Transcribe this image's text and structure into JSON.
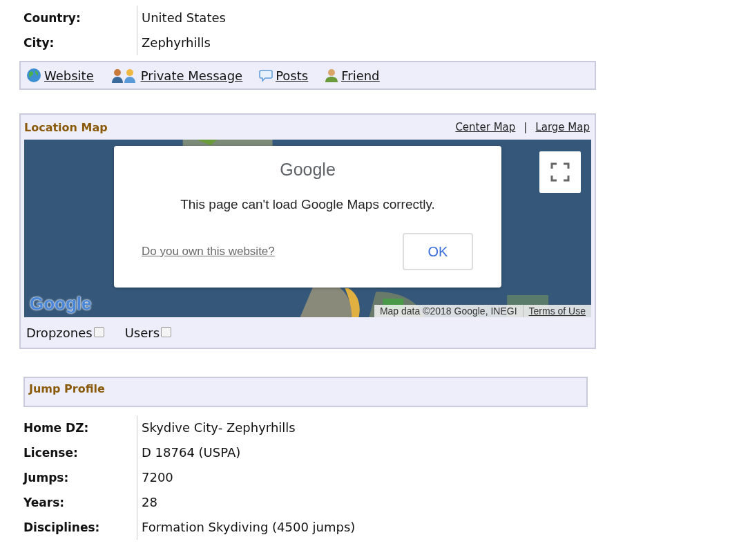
{
  "location_rows": [
    {
      "label": "Country:",
      "value": "United States"
    },
    {
      "label": "City:",
      "value": "Zephyrhills"
    }
  ],
  "links": [
    {
      "kind": "globe",
      "label": "Website"
    },
    {
      "kind": "people",
      "label": "Private Message"
    },
    {
      "kind": "bubble",
      "label": "Posts"
    },
    {
      "kind": "person",
      "label": "Friend"
    }
  ],
  "location_map": {
    "title": "Location Map",
    "actions": [
      "Center Map",
      "Large Map"
    ],
    "separator": "|",
    "map": {
      "kind": "picture",
      "logo": "Google",
      "attribution": "Map data ©2018 Google, INEGI",
      "terms": "Terms of Use"
    },
    "dialog": {
      "logo": "Google",
      "message": "This page can't load Google Maps correctly.",
      "link": "Do you own this website?",
      "button": "OK"
    },
    "filters": [
      {
        "label": "Dropzones",
        "checked": false
      },
      {
        "label": "Users",
        "checked": false
      }
    ]
  },
  "jump_profile": {
    "title": "Jump Profile"
  },
  "profile_rows": [
    {
      "label": "Home DZ:",
      "value": "Skydive City- Zephyrhills"
    },
    {
      "label": "License:",
      "value": "D 18764 (USPA)"
    },
    {
      "label": "Jumps:",
      "value": "7200"
    },
    {
      "label": "Years:",
      "value": "28"
    },
    {
      "label": "Disciplines:",
      "value": "Formation Skydiving (4500 jumps)"
    }
  ]
}
